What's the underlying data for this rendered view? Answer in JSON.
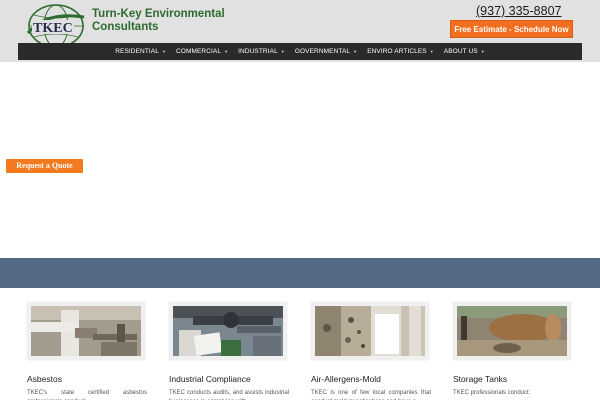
{
  "brand": {
    "logo_text": "TKEC",
    "name_line1": "Turn-Key Environmental",
    "name_line2": "Consultants"
  },
  "header": {
    "phone": "(937) 335-8807",
    "cta_label": "Free Estimate - Schedule Now"
  },
  "nav": {
    "items": [
      {
        "label": "RESIDENTIAL"
      },
      {
        "label": "COMMERCIAL"
      },
      {
        "label": "INDUSTRIAL"
      },
      {
        "label": "GOVERNMENTAL"
      },
      {
        "label": "ENVIRO ARTICLES"
      },
      {
        "label": "ABOUT US"
      }
    ]
  },
  "hero": {
    "quote_button": "Request a Quote"
  },
  "services": [
    {
      "title": "Asbestos",
      "text": "TKEC's state certified asbestos professionals conduct",
      "image_icon": "pipe-insulation-photo"
    },
    {
      "title": "Industrial Compliance",
      "text": "TKEC conducts audits, and assists industrial businesses in complying with",
      "image_icon": "inspector-clipboard-photo"
    },
    {
      "title": "Air-Allergens-Mold",
      "text": "TKEC is one of few local companies that conduct mold investigations and have a",
      "image_icon": "moldy-wall-photo"
    },
    {
      "title": "Storage Tanks",
      "text": "TKEC professionals conduct:",
      "image_icon": "removed-tank-photo"
    }
  ],
  "colors": {
    "header_bg": "#e1e1e1",
    "brand_green": "#2e6b2f",
    "cta_orange": "#f26f21",
    "nav_bg": "#2a2a2a",
    "band_blue": "#536a82"
  }
}
